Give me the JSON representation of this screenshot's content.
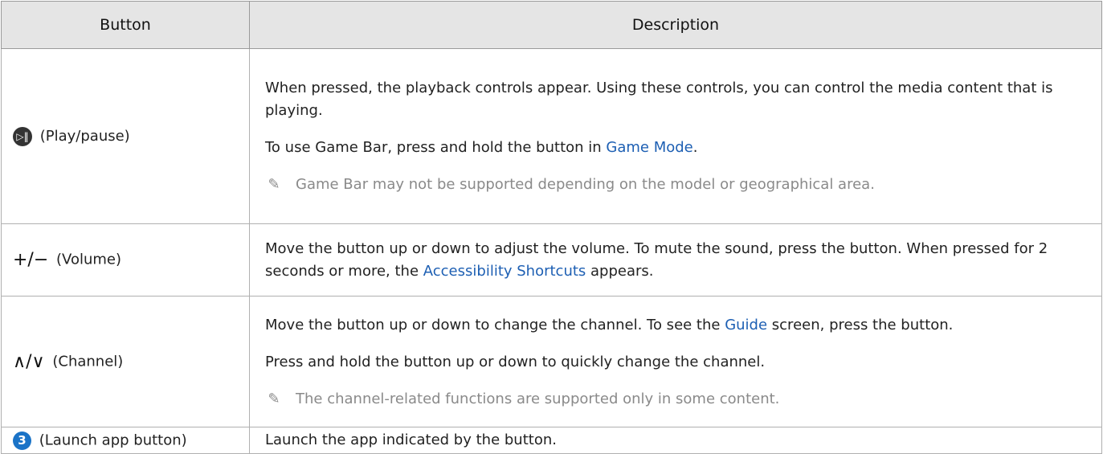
{
  "headers": {
    "button": "Button",
    "description": "Description"
  },
  "rows": [
    {
      "button_label": "(Play/pause)",
      "icon": "play-pause-icon",
      "paragraphs": [
        {
          "text": "When pressed, the playback controls appear. Using these controls, you can control the media content that is playing."
        },
        {
          "pre": "To use Game Bar, press and hold the button in ",
          "link": "Game Mode",
          "post": "."
        }
      ],
      "note": "Game Bar may not be supported depending on the model or geographical area."
    },
    {
      "button_label": "(Volume)",
      "icon": "volume-plus-minus-icon",
      "icon_text": "+/−",
      "paragraphs": [
        {
          "pre": "Move the button up or down to adjust the volume. To mute the sound, press the button. When pressed for 2 seconds or more, the ",
          "link": "Accessibility Shortcuts",
          "post": " appears."
        }
      ]
    },
    {
      "button_label": "(Channel)",
      "icon": "channel-up-down-icon",
      "icon_text": "∧/∨",
      "paragraphs": [
        {
          "pre": "Move the button up or down to change the channel. To see the ",
          "link": "Guide",
          "post": " screen, press the button."
        },
        {
          "text": "Press and hold the button up or down to quickly change the channel."
        }
      ],
      "note": "The channel-related functions are supported only in some content."
    },
    {
      "button_label": "(Launch app button)",
      "icon": "number-3-icon",
      "icon_text": "3",
      "paragraphs": [
        {
          "text": "Launch the app indicated by the button."
        }
      ]
    }
  ],
  "colors": {
    "link": "#1d5fb3",
    "header_bg": "#e5e5e5",
    "note": "#8a8a8a",
    "badge": "#1a73c7"
  }
}
